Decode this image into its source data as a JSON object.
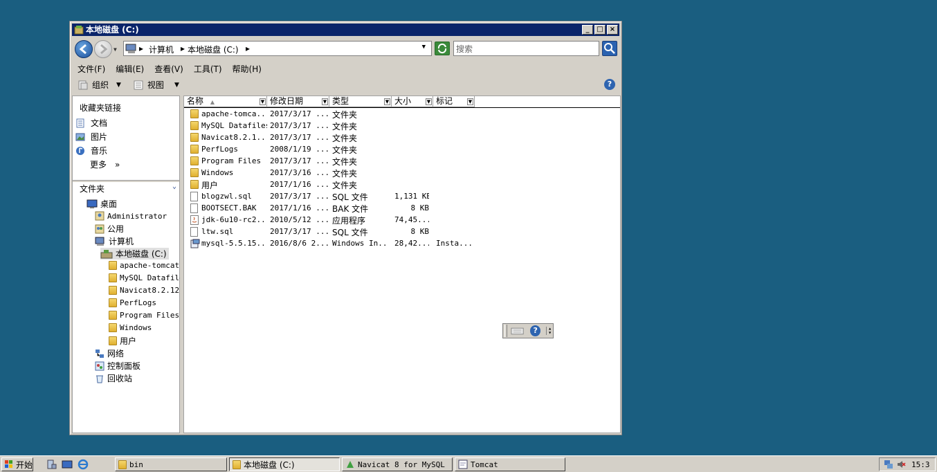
{
  "window": {
    "title": "本地磁盘 (C:)",
    "controls": {
      "minimize": "_",
      "maximize": "□",
      "close": "×"
    }
  },
  "address_bar": {
    "breadcrumbs": [
      "计算机",
      "本地磁盘 (C:)"
    ],
    "search_placeholder": "搜索"
  },
  "menu": [
    "文件(F)",
    "编辑(E)",
    "查看(V)",
    "工具(T)",
    "帮助(H)"
  ],
  "toolbar": {
    "organize": "组织",
    "views": "视图",
    "help": "?"
  },
  "favorites": {
    "title": "收藏夹链接",
    "items": [
      "文档",
      "图片",
      "音乐"
    ],
    "more": "更多",
    "more_glyph": "»"
  },
  "folders": {
    "title": "文件夹",
    "desktop": "桌面",
    "administrator": "Administrator",
    "public": "公用",
    "computer": "计算机",
    "local_disk": "本地磁盘 (C:)",
    "subfolders": [
      "apache-tomcat-",
      "MySQL Datafile",
      "Navicat8.2.12",
      "PerfLogs",
      "Program Files",
      "Windows",
      "用户"
    ],
    "network": "网络",
    "control_panel": "控制面板",
    "recycle_bin": "回收站"
  },
  "columns": [
    "名称",
    "修改日期",
    "类型",
    "大小",
    "标记"
  ],
  "files": [
    {
      "name": "apache-tomca...",
      "date": "2017/3/17 ...",
      "type": "文件夹",
      "size": "",
      "tag": "",
      "kind": "folder"
    },
    {
      "name": "MySQL Datafiles",
      "date": "2017/3/17 ...",
      "type": "文件夹",
      "size": "",
      "tag": "",
      "kind": "folder"
    },
    {
      "name": "Navicat8.2.1...",
      "date": "2017/3/17 ...",
      "type": "文件夹",
      "size": "",
      "tag": "",
      "kind": "folder"
    },
    {
      "name": "PerfLogs",
      "date": "2008/1/19 ...",
      "type": "文件夹",
      "size": "",
      "tag": "",
      "kind": "folder"
    },
    {
      "name": "Program Files",
      "date": "2017/3/17 ...",
      "type": "文件夹",
      "size": "",
      "tag": "",
      "kind": "folder"
    },
    {
      "name": "Windows",
      "date": "2017/3/16 ...",
      "type": "文件夹",
      "size": "",
      "tag": "",
      "kind": "folder"
    },
    {
      "name": "用户",
      "date": "2017/1/16 ...",
      "type": "文件夹",
      "size": "",
      "tag": "",
      "kind": "folder"
    },
    {
      "name": "blogzwl.sql",
      "date": "2017/3/17 ...",
      "type": "SQL 文件",
      "size": "1,131 KB",
      "tag": "",
      "kind": "file"
    },
    {
      "name": "BOOTSECT.BAK",
      "date": "2017/1/16 ...",
      "type": "BAK 文件",
      "size": "8 KB",
      "tag": "",
      "kind": "file"
    },
    {
      "name": "jdk-6u10-rc2...",
      "date": "2010/5/12 ...",
      "type": "应用程序",
      "size": "74,45...",
      "tag": "",
      "kind": "java"
    },
    {
      "name": "ltw.sql",
      "date": "2017/3/17 ...",
      "type": "SQL 文件",
      "size": "8 KB",
      "tag": "",
      "kind": "file"
    },
    {
      "name": "mysql-5.5.15...",
      "date": "2016/8/6 2...",
      "type": "Windows In...",
      "size": "28,42...",
      "tag": "Insta...",
      "kind": "installer"
    }
  ],
  "taskbar": {
    "start": "开始",
    "tasks": [
      "bin",
      "本地磁盘 (C:)",
      "Navicat 8 for MySQL",
      "Tomcat"
    ],
    "clock": "15:3"
  },
  "colors": {
    "desktop": "#1a5e80",
    "titlebar": "#0a246a",
    "chrome": "#d4d0c8"
  }
}
